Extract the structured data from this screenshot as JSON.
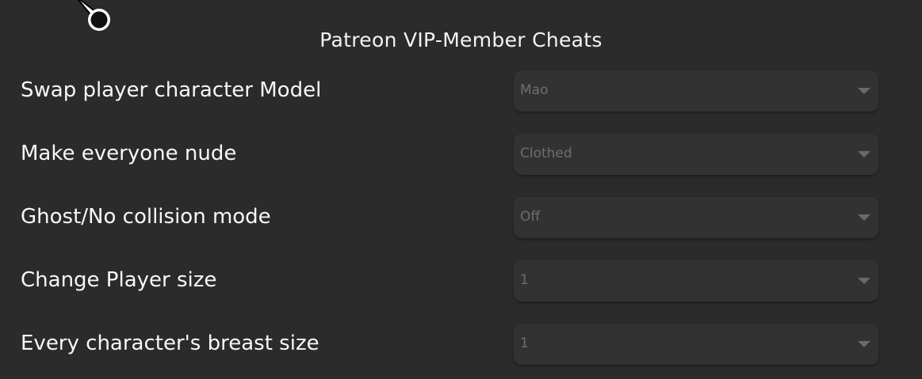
{
  "panel": {
    "title": "Patreon VIP-Member Cheats"
  },
  "options": [
    {
      "label": "Swap player character Model",
      "value": "Mao"
    },
    {
      "label": "Make everyone nude",
      "value": "Clothed"
    },
    {
      "label": "Ghost/No collision mode",
      "value": "Off"
    },
    {
      "label": "Change Player size",
      "value": "1"
    },
    {
      "label": "Every character's breast size",
      "value": "1"
    }
  ],
  "icons": {
    "dropdown_arrow": "chevron-down-icon",
    "pointer": "cursor-icon"
  },
  "colors": {
    "background": "#2b2b2b",
    "dropdown_bg": "#323232",
    "label_text": "#f7f7f7",
    "value_text": "#6e6e6e"
  }
}
